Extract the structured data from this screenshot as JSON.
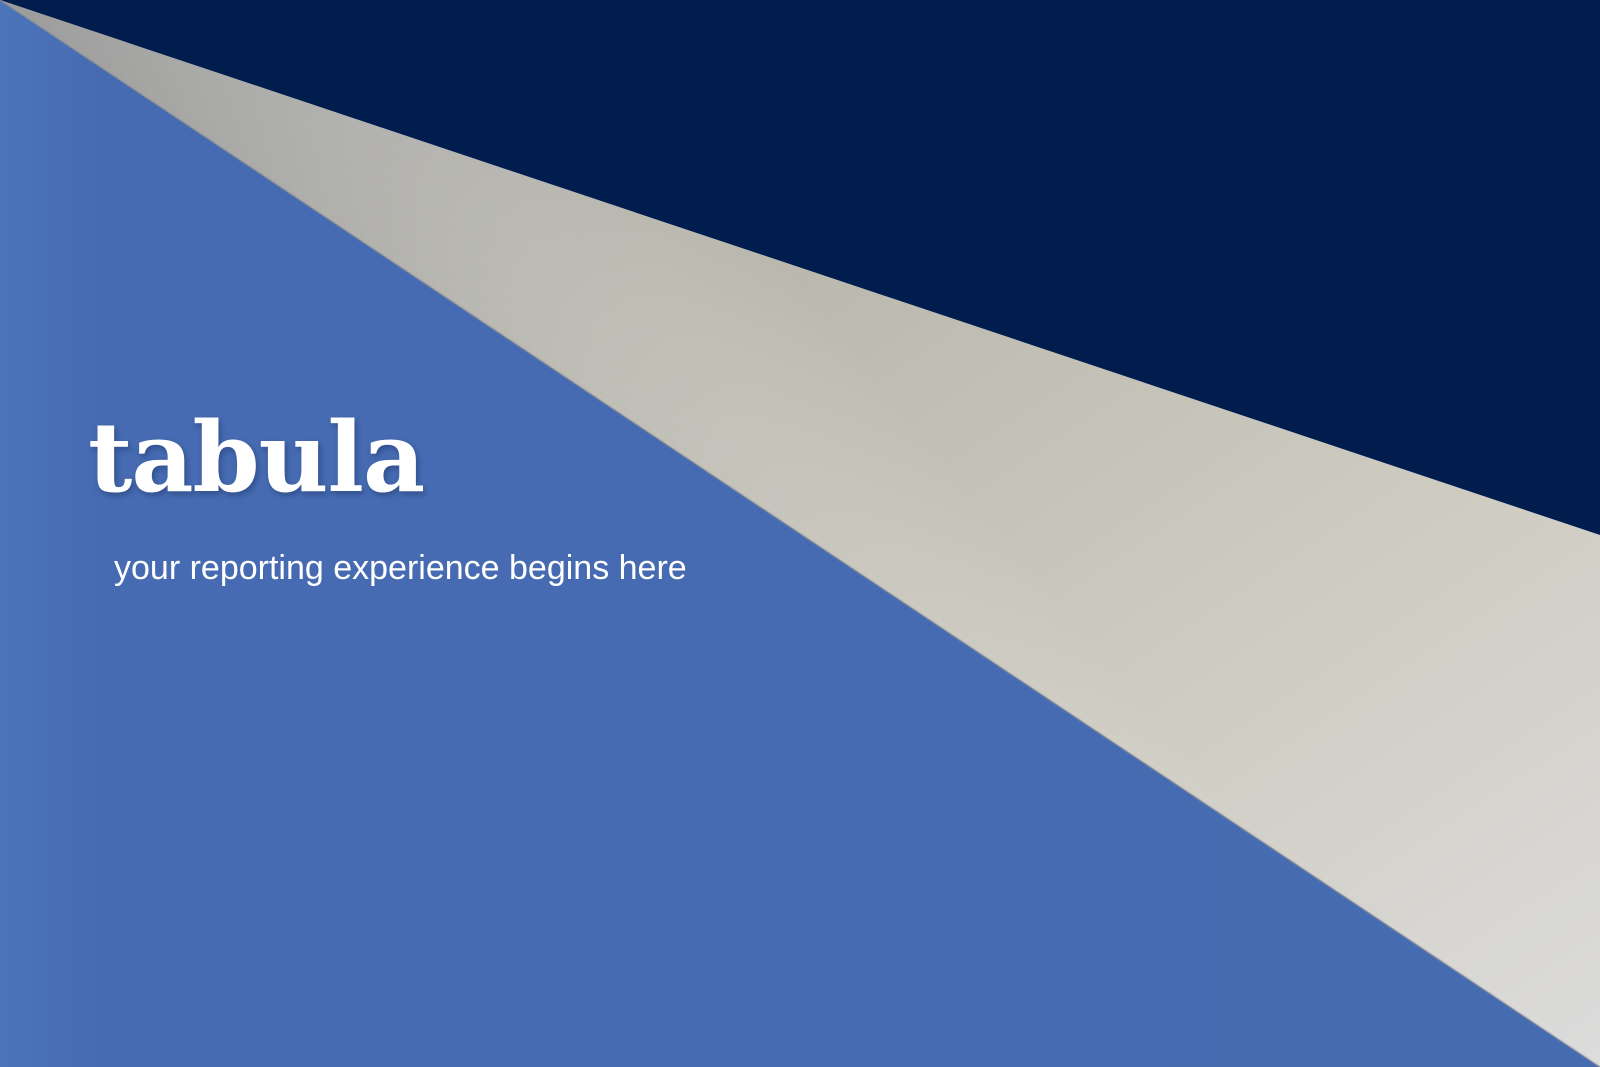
{
  "brand": {
    "name": "tabula",
    "tagline": "your reporting experience begins here"
  },
  "colors": {
    "navy_panel": "#001d4e",
    "blue_panel": "#466cb2",
    "paper_fold": "#c9c6bb",
    "text": "#ffffff"
  }
}
